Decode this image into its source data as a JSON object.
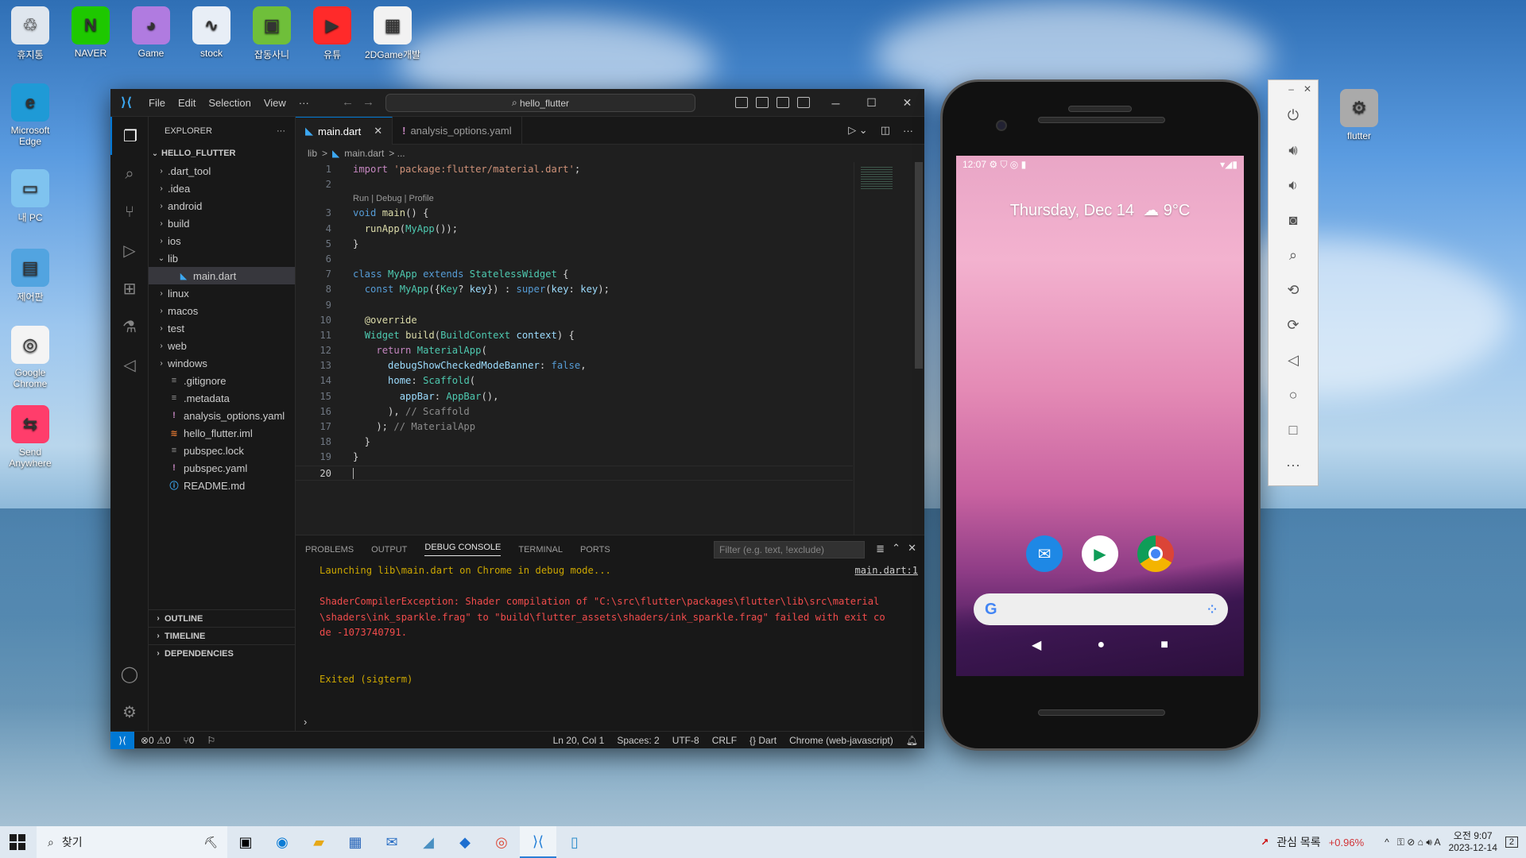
{
  "desktop": {
    "icons_top": [
      {
        "label": "휴지통",
        "icon": "recycle-bin-icon"
      },
      {
        "label": "NAVER",
        "icon": "naver-icon"
      },
      {
        "label": "Game",
        "icon": "game-icon"
      },
      {
        "label": "stock",
        "icon": "stock-icon"
      },
      {
        "label": "잡동사니",
        "icon": "folder-icon"
      },
      {
        "label": "유튜",
        "icon": "youtube-icon"
      },
      {
        "label": "2DGame개발",
        "icon": "game-dev-icon"
      }
    ],
    "icons_left": [
      {
        "label": "Microsoft Edge",
        "icon": "edge-icon"
      },
      {
        "label": "내 PC",
        "icon": "pc-icon"
      },
      {
        "label": "제어판",
        "icon": "control-panel-icon"
      },
      {
        "label": "Google Chrome",
        "icon": "chrome-icon"
      },
      {
        "label": "Send Anywhere",
        "icon": "send-anywhere-icon"
      }
    ],
    "icon_right": {
      "label": "flutter",
      "icon": "flutter-folder-icon"
    }
  },
  "vscode": {
    "menu": [
      "File",
      "Edit",
      "Selection",
      "View",
      "···"
    ],
    "search_title": "hello_flutter",
    "explorer_title": "EXPLORER",
    "project": "HELLO_FLUTTER",
    "tree": [
      {
        "name": ".dart_tool",
        "type": "folder",
        "depth": 0
      },
      {
        "name": ".idea",
        "type": "folder",
        "depth": 0
      },
      {
        "name": "android",
        "type": "folder",
        "depth": 0
      },
      {
        "name": "build",
        "type": "folder",
        "depth": 0
      },
      {
        "name": "ios",
        "type": "folder",
        "depth": 0
      },
      {
        "name": "lib",
        "type": "folder-open",
        "depth": 0
      },
      {
        "name": "main.dart",
        "type": "dart",
        "depth": 1,
        "selected": true
      },
      {
        "name": "linux",
        "type": "folder",
        "depth": 0
      },
      {
        "name": "macos",
        "type": "folder",
        "depth": 0
      },
      {
        "name": "test",
        "type": "folder",
        "depth": 0
      },
      {
        "name": "web",
        "type": "folder",
        "depth": 0
      },
      {
        "name": "windows",
        "type": "folder",
        "depth": 0
      },
      {
        "name": ".gitignore",
        "type": "file",
        "depth": 0
      },
      {
        "name": ".metadata",
        "type": "file",
        "depth": 0
      },
      {
        "name": "analysis_options.yaml",
        "type": "yaml",
        "depth": 0
      },
      {
        "name": "hello_flutter.iml",
        "type": "iml",
        "depth": 0
      },
      {
        "name": "pubspec.lock",
        "type": "file",
        "depth": 0
      },
      {
        "name": "pubspec.yaml",
        "type": "yaml",
        "depth": 0
      },
      {
        "name": "README.md",
        "type": "info",
        "depth": 0
      }
    ],
    "sections": [
      "OUTLINE",
      "TIMELINE",
      "DEPENDENCIES"
    ],
    "tabs": [
      {
        "label": "main.dart",
        "active": true
      },
      {
        "label": "analysis_options.yaml",
        "active": false
      }
    ],
    "breadcrumb": [
      "lib",
      ">",
      "main.dart",
      "> ..."
    ],
    "codelens": "Run | Debug | Profile",
    "code_lines": [
      {
        "n": "1",
        "html": "<span class='kw2'>import</span> <span class='str'>'package:flutter/material.dart'</span>;"
      },
      {
        "n": "2",
        "html": ""
      },
      {
        "n": "3",
        "html": "<span class='kw'>void</span> <span class='fn'>main</span>() {"
      },
      {
        "n": "4",
        "html": "  <span class='fn'>runApp</span>(<span class='ty'>MyApp</span>());"
      },
      {
        "n": "5",
        "html": "}"
      },
      {
        "n": "6",
        "html": ""
      },
      {
        "n": "7",
        "html": "<span class='kw'>class</span> <span class='ty'>MyApp</span> <span class='kw'>extends</span> <span class='ty'>StatelessWidget</span> {"
      },
      {
        "n": "8",
        "html": "  <span class='kw'>const</span> <span class='ty'>MyApp</span>({<span class='ty'>Key</span>? <span class='var'>key</span>}) : <span class='kw'>super</span>(<span class='var'>key</span>: <span class='var'>key</span>);"
      },
      {
        "n": "9",
        "html": ""
      },
      {
        "n": "10",
        "html": "  <span class='ann'>@override</span>"
      },
      {
        "n": "11",
        "html": "  <span class='ty'>Widget</span> <span class='fn'>build</span>(<span class='ty'>BuildContext</span> <span class='var'>context</span>) {"
      },
      {
        "n": "12",
        "html": "    <span class='kw2'>return</span> <span class='ty'>MaterialApp</span>("
      },
      {
        "n": "13",
        "html": "      <span class='var'>debugShowCheckedModeBanner</span>: <span class='kw'>false</span>,"
      },
      {
        "n": "14",
        "html": "      <span class='var'>home</span>: <span class='ty'>Scaffold</span>("
      },
      {
        "n": "15",
        "html": "        <span class='var'>appBar</span>: <span class='ty'>AppBar</span>(),"
      },
      {
        "n": "16",
        "html": "      ), <span class='ghost'>// Scaffold</span>"
      },
      {
        "n": "17",
        "html": "    ); <span class='ghost'>// MaterialApp</span>"
      },
      {
        "n": "18",
        "html": "  }"
      },
      {
        "n": "19",
        "html": "}"
      },
      {
        "n": "20",
        "html": ""
      }
    ],
    "panel_tabs": [
      "PROBLEMS",
      "OUTPUT",
      "DEBUG CONSOLE",
      "TERMINAL",
      "PORTS"
    ],
    "panel_active": "DEBUG CONSOLE",
    "filter_placeholder": "Filter (e.g. text, !exclude)",
    "console_link": "main.dart:1",
    "console": [
      {
        "text": "Launching lib\\main.dart on Chrome in debug mode...",
        "cls": "warn"
      },
      {
        "text": "",
        "cls": ""
      },
      {
        "text": "ShaderCompilerException: Shader compilation of \"C:\\src\\flutter\\packages\\flutter\\lib\\src\\material",
        "cls": "err"
      },
      {
        "text": "\\shaders\\ink_sparkle.frag\" to \"build\\flutter_assets\\shaders/ink_sparkle.frag\" failed with exit co",
        "cls": "err"
      },
      {
        "text": "de -1073740791.",
        "cls": "err"
      },
      {
        "text": "",
        "cls": ""
      },
      {
        "text": "",
        "cls": ""
      },
      {
        "text": "Exited (sigterm)",
        "cls": "warn"
      }
    ],
    "status": {
      "problems": "⊗0 ⚠0",
      "ports": "⑂0",
      "position": "Ln 20, Col 1",
      "spaces": "Spaces: 2",
      "encoding": "UTF-8",
      "eol": "CRLF",
      "language": "{} Dart",
      "device": "Chrome (web-javascript)"
    }
  },
  "phone": {
    "time": "12:07",
    "date": "Thursday, Dec 14",
    "weather": "☁ 9°C",
    "dock_apps": [
      "messages-icon",
      "play-store-icon",
      "chrome-icon"
    ]
  },
  "emulator_toolbar": [
    "power-icon",
    "volume-up-icon",
    "volume-down-icon",
    "camera-icon",
    "zoom-icon",
    "rotate-left-icon",
    "rotate-right-icon",
    "back-icon",
    "home-icon",
    "overview-icon",
    "more-icon"
  ],
  "taskbar": {
    "search_label": "찾기",
    "stock_label": "관심 목록",
    "stock_change": "+0.96%",
    "time": "오전 9:07",
    "date": "2023-12-14",
    "notif": "2"
  }
}
